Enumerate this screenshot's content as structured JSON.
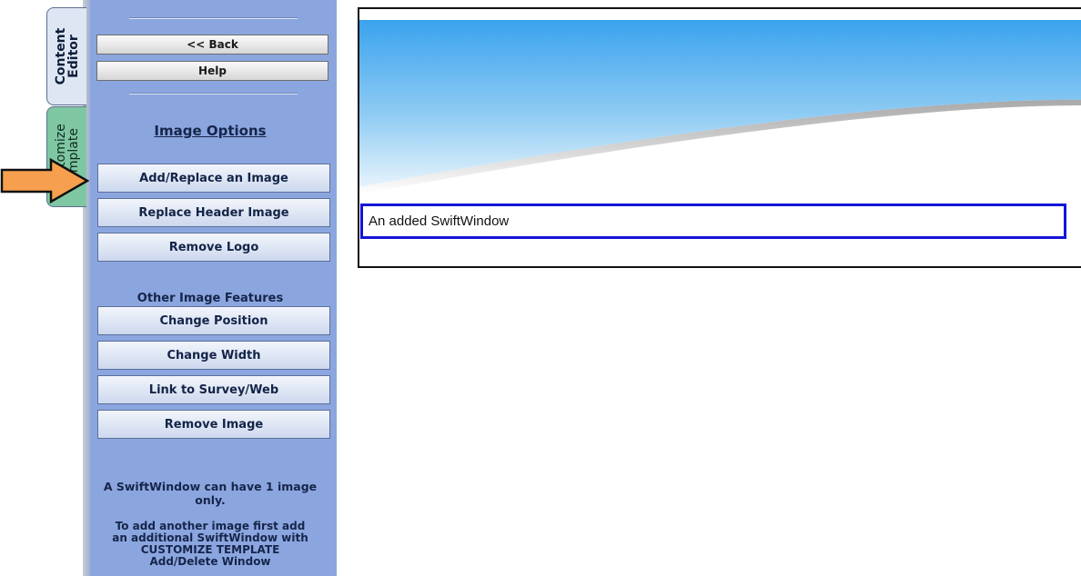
{
  "tabs": {
    "content_editor": [
      "Content",
      "Editor"
    ],
    "customize_template": [
      "Customize",
      "Template"
    ]
  },
  "panel": {
    "back_label": "<< Back",
    "help_label": "Help",
    "section_title": "Image Options",
    "buttons": [
      "Add/Replace an Image",
      "Replace Header Image",
      "Remove Logo"
    ],
    "other_features_title": "Other Image Features",
    "other_buttons": [
      "Change Position",
      "Change Width",
      "Link to Survey/Web",
      "Remove Image"
    ],
    "note1_line1": "A SwiftWindow can have 1 image",
    "note1_line2": "only.",
    "note2_line1": "To add another image first add",
    "note2_line2": "an additional SwiftWindow with",
    "note2_line3": "CUSTOMIZE TEMPLATE",
    "note2_line4": "Add/Delete Window"
  },
  "preview": {
    "swiftwindow_text": "An added SwiftWindow"
  },
  "colors": {
    "panel_bg": "#8ba6df",
    "arrow": "#f6a04f",
    "swiftwindow_border": "#1414d8"
  },
  "icons": {
    "arrow": "arrow-right-icon"
  }
}
